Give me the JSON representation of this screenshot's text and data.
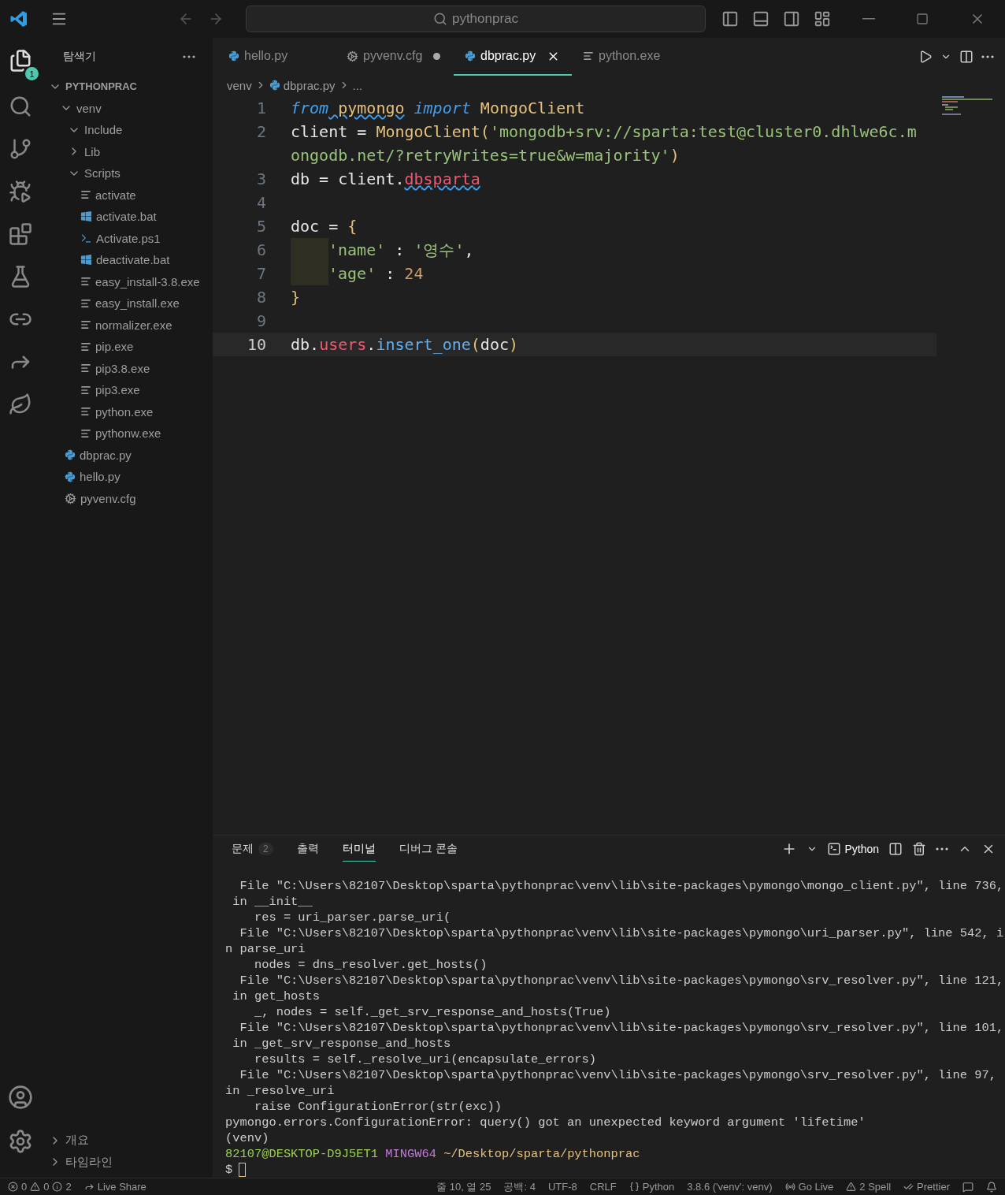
{
  "title_bar": {
    "search": "pythonprac"
  },
  "activity_bar": {
    "badge": "1"
  },
  "sidebar": {
    "title": "탐색기",
    "root": "PYTHONPRAC",
    "root_expanded": true,
    "tree": [
      {
        "name": "venv",
        "kind": "folder",
        "expanded": true,
        "children": [
          {
            "name": "Include",
            "kind": "folder",
            "expanded": true
          },
          {
            "name": "Lib",
            "kind": "folder",
            "expanded": false
          },
          {
            "name": "Scripts",
            "kind": "folder",
            "expanded": true,
            "children": [
              {
                "name": "activate",
                "kind": "text"
              },
              {
                "name": "activate.bat",
                "kind": "windows"
              },
              {
                "name": "Activate.ps1",
                "kind": "shell"
              },
              {
                "name": "deactivate.bat",
                "kind": "windows"
              },
              {
                "name": "easy_install-3.8.exe",
                "kind": "text"
              },
              {
                "name": "easy_install.exe",
                "kind": "text"
              },
              {
                "name": "normalizer.exe",
                "kind": "text"
              },
              {
                "name": "pip.exe",
                "kind": "text"
              },
              {
                "name": "pip3.8.exe",
                "kind": "text"
              },
              {
                "name": "pip3.exe",
                "kind": "text"
              },
              {
                "name": "python.exe",
                "kind": "text"
              },
              {
                "name": "pythonw.exe",
                "kind": "text"
              }
            ]
          }
        ]
      },
      {
        "name": "dbprac.py",
        "kind": "python"
      },
      {
        "name": "hello.py",
        "kind": "python"
      },
      {
        "name": "pyvenv.cfg",
        "kind": "config"
      }
    ],
    "sections": [
      {
        "label": "개요",
        "expanded": false
      },
      {
        "label": "타임라인",
        "expanded": false
      }
    ]
  },
  "tabs": [
    {
      "label": "hello.py",
      "kind": "python",
      "selected": false,
      "modified": false
    },
    {
      "label": "pyvenv.cfg",
      "kind": "config",
      "selected": false,
      "modified": true
    },
    {
      "label": "dbprac.py",
      "kind": "python",
      "selected": true,
      "modified": false
    },
    {
      "label": "python.exe",
      "kind": "text",
      "selected": false,
      "modified": false
    }
  ],
  "breadcrumb": [
    "venv",
    "dbprac.py",
    "..."
  ],
  "code": [
    {
      "number": "1",
      "indent": false,
      "current": false,
      "tokens": [
        {
          "text": "from",
          "kind": "keyword"
        },
        {
          "text": " pymongo",
          "kind": "class",
          "squiggle": true
        },
        {
          "text": " import",
          "kind": "keyword"
        },
        {
          "text": " MongoClient",
          "kind": "class"
        }
      ]
    },
    {
      "number": "2",
      "indent": false,
      "current": false,
      "tokens": [
        {
          "text": "client = ",
          "kind": "plain"
        },
        {
          "text": "MongoClient",
          "kind": "class"
        },
        {
          "text": "(",
          "kind": "bracket"
        },
        {
          "text": "'mongodb+srv://sparta:test@cluster0.dhlwe6c.mongodb.net/?retryWrites=true&w=majority'",
          "kind": "string"
        },
        {
          "text": ")",
          "kind": "bracket"
        }
      ]
    },
    {
      "number": "3",
      "indent": false,
      "current": false,
      "tokens": [
        {
          "text": "db = client.",
          "kind": "plain"
        },
        {
          "text": "dbsparta",
          "kind": "property",
          "squiggle": true
        }
      ]
    },
    {
      "number": "4",
      "indent": false,
      "current": false
    },
    {
      "number": "5",
      "indent": false,
      "current": false,
      "tokens": [
        {
          "text": "doc = ",
          "kind": "plain"
        },
        {
          "text": "{",
          "kind": "bracket"
        }
      ]
    },
    {
      "number": "6",
      "indent": true,
      "current": false,
      "tokens": [
        {
          "text": "'name'",
          "kind": "string"
        },
        {
          "text": " : ",
          "kind": "plain"
        },
        {
          "text": "'영수'",
          "kind": "string"
        },
        {
          "text": ",",
          "kind": "plain"
        }
      ]
    },
    {
      "number": "7",
      "indent": true,
      "current": false,
      "tokens": [
        {
          "text": "'age'",
          "kind": "string"
        },
        {
          "text": " : ",
          "kind": "plain"
        },
        {
          "text": "24",
          "kind": "number"
        }
      ]
    },
    {
      "number": "8",
      "indent": false,
      "current": false,
      "tokens": [
        {
          "text": "}",
          "kind": "bracket"
        }
      ]
    },
    {
      "number": "9",
      "indent": false,
      "current": false
    },
    {
      "number": "10",
      "indent": false,
      "current": true,
      "tokens": [
        {
          "text": "db.",
          "kind": "plain"
        },
        {
          "text": "users",
          "kind": "property"
        },
        {
          "text": ".",
          "kind": "plain"
        },
        {
          "text": "insert_one",
          "kind": "function"
        },
        {
          "text": "(",
          "kind": "bracket"
        },
        {
          "text": "doc",
          "kind": "plain"
        },
        {
          "text": ")",
          "kind": "bracket"
        }
      ]
    }
  ],
  "panel": {
    "tabs": [
      {
        "label": "문제",
        "badge": "2",
        "selected": false
      },
      {
        "label": "출력",
        "selected": false
      },
      {
        "label": "터미널",
        "selected": true
      },
      {
        "label": "디버그 콘솔",
        "selected": false
      }
    ],
    "shell": "Python",
    "terminal": [
      "  File \"C:\\Users\\82107\\Desktop\\sparta\\pythonprac\\venv\\lib\\site-packages\\pymongo\\mongo_client.py\", line 736,",
      " in __init__",
      "    res = uri_parser.parse_uri(",
      "  File \"C:\\Users\\82107\\Desktop\\sparta\\pythonprac\\venv\\lib\\site-packages\\pymongo\\uri_parser.py\", line 542, i",
      "n parse_uri",
      "    nodes = dns_resolver.get_hosts()",
      "  File \"C:\\Users\\82107\\Desktop\\sparta\\pythonprac\\venv\\lib\\site-packages\\pymongo\\srv_resolver.py\", line 121,",
      " in get_hosts",
      "    _, nodes = self._get_srv_response_and_hosts(True)",
      "  File \"C:\\Users\\82107\\Desktop\\sparta\\pythonprac\\venv\\lib\\site-packages\\pymongo\\srv_resolver.py\", line 101,",
      " in _get_srv_response_and_hosts",
      "    results = self._resolve_uri(encapsulate_errors)",
      "  File \"C:\\Users\\82107\\Desktop\\sparta\\pythonprac\\venv\\lib\\site-packages\\pymongo\\srv_resolver.py\", line 97,",
      "in _resolve_uri",
      "    raise ConfigurationError(str(exc))",
      "pymongo.errors.ConfigurationError: query() got an unexpected keyword argument 'lifetime'",
      "(venv)"
    ],
    "prompt": {
      "user": "82107@DESKTOP-D9J5ET1",
      "shell": "MINGW64",
      "path": "~/Desktop/sparta/pythonprac",
      "symbol": "$"
    }
  },
  "status_bar": {
    "errors": "0",
    "warnings": "0",
    "infos": "2",
    "left": [
      {
        "label": "Live Share",
        "kind": "share"
      }
    ],
    "right": [
      {
        "label": "줄 10, 열 25",
        "kind": "plain"
      },
      {
        "label": "공백: 4",
        "kind": "plain"
      },
      {
        "label": "UTF-8",
        "kind": "plain"
      },
      {
        "label": "CRLF",
        "kind": "plain"
      },
      {
        "label": "Python",
        "kind": "braces"
      },
      {
        "label": "3.8.6 ('venv': venv)",
        "kind": "plain"
      },
      {
        "label": "Go Live",
        "kind": "live"
      },
      {
        "label": "2 Spell",
        "kind": "warning"
      },
      {
        "label": "Prettier",
        "kind": "check"
      }
    ]
  }
}
